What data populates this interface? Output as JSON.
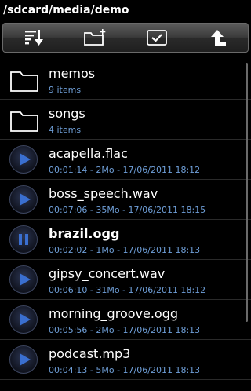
{
  "path": "/sdcard/media/demo",
  "toolbar": {
    "buttons": [
      {
        "icon": "sort-down-icon"
      },
      {
        "icon": "new-folder-icon"
      },
      {
        "icon": "select-checkbox-icon"
      },
      {
        "icon": "up-directory-icon"
      }
    ]
  },
  "items": [
    {
      "type": "folder",
      "name": "memos",
      "sub": "9 items",
      "icon": "folder-icon"
    },
    {
      "type": "folder",
      "name": "songs",
      "sub": "4 items",
      "icon": "folder-icon"
    },
    {
      "type": "audio",
      "name": "acapella.flac",
      "sub": "00:01:14 - 2Mo - 17/06/2011 18:12",
      "state": "stopped",
      "icon": "play-icon"
    },
    {
      "type": "audio",
      "name": "boss_speech.wav",
      "sub": "00:07:06 - 35Mo - 17/06/2011 18:15",
      "state": "stopped",
      "icon": "play-icon"
    },
    {
      "type": "audio",
      "name": "brazil.ogg",
      "sub": "00:02:02 - 1Mo - 17/06/2011 18:13",
      "state": "playing",
      "icon": "pause-icon"
    },
    {
      "type": "audio",
      "name": "gipsy_concert.wav",
      "sub": "00:06:10 - 31Mo - 17/06/2011 18:12",
      "state": "stopped",
      "icon": "play-icon"
    },
    {
      "type": "audio",
      "name": "morning_groove.ogg",
      "sub": "00:05:56 - 2Mo - 17/06/2011 18:13",
      "state": "stopped",
      "icon": "play-icon"
    },
    {
      "type": "audio",
      "name": "podcast.mp3",
      "sub": "00:04:13 - 5Mo - 17/06/2011 18:13",
      "state": "stopped",
      "icon": "play-icon"
    }
  ],
  "colors": {
    "background": "#000000",
    "subtext": "#6f9fd8",
    "play_accent": "#3a6fd0"
  }
}
